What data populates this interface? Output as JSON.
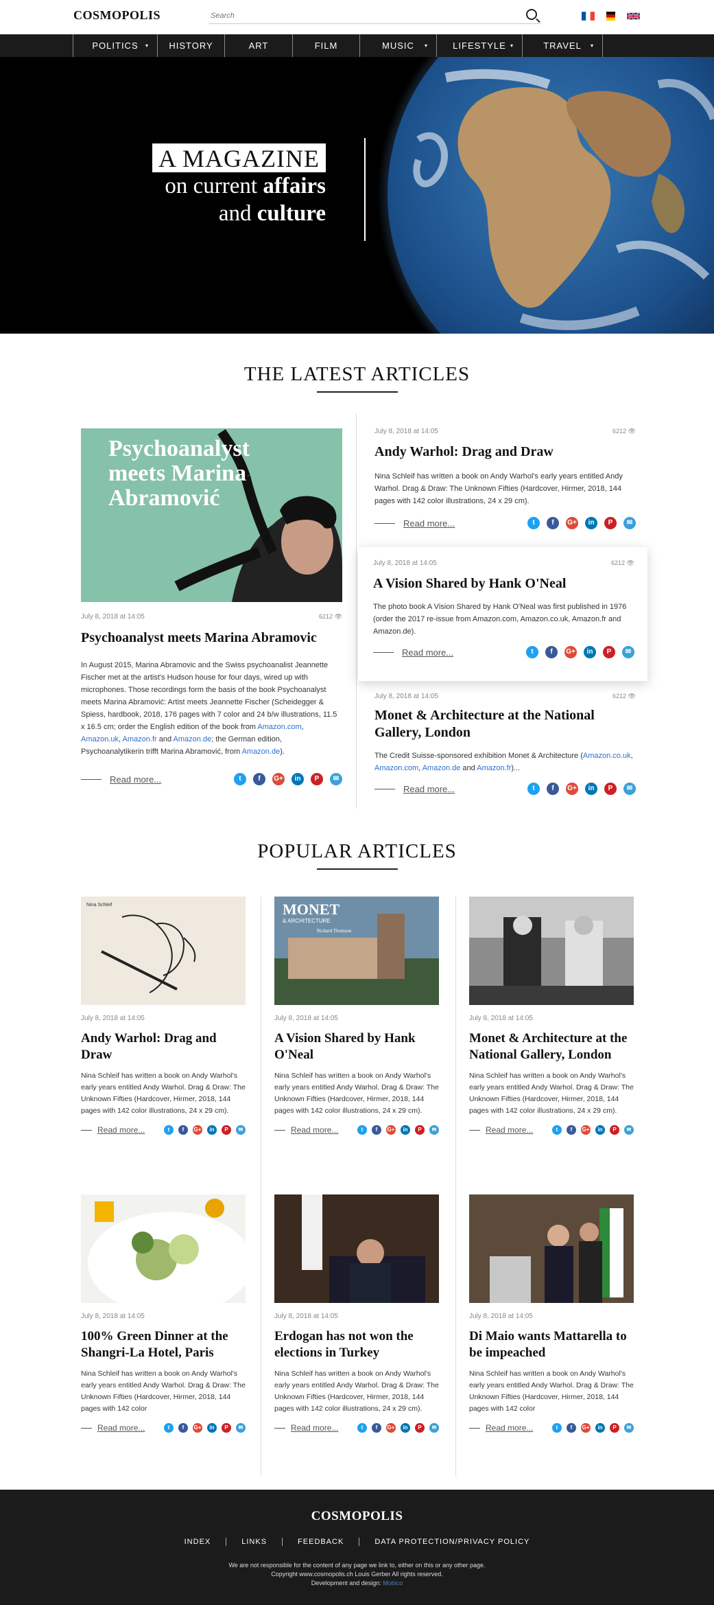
{
  "header": {
    "logo": "COSMOPOLIS",
    "search_placeholder": "Search",
    "flags": [
      "fr",
      "de",
      "gb"
    ]
  },
  "nav": [
    {
      "label": "POLITICS",
      "dropdown": true
    },
    {
      "label": "HISTORY",
      "dropdown": false
    },
    {
      "label": "ART",
      "dropdown": false
    },
    {
      "label": "FILM",
      "dropdown": false
    },
    {
      "label": "MUSIC",
      "dropdown": true
    },
    {
      "label": "LIFESTYLE",
      "dropdown": true
    },
    {
      "label": "TRAVEL",
      "dropdown": true
    }
  ],
  "hero": {
    "tag": "A MAGAZINE",
    "line1a": "on current ",
    "line1b": "affairs",
    "line2a": "and ",
    "line2b": "culture"
  },
  "latest": {
    "title": "THE LATEST ARTICLES",
    "feature": {
      "image_text": "Psychoanalyst meets Marina Abramović",
      "date": "July 8, 2018 at 14:05",
      "views": "6212",
      "title": "Psychoanalyst meets Marina Abramovic",
      "body_parts": [
        {
          "t": "In August 2015, Marina Abramovic and the Swiss psychoanalist Jeannette Fischer met at the artist's Hudson house for four days, wired up with microphones. Those recordings form the basis of the book Psychoanalyst meets Marina Abramović: Artist meets Jeannette Fischer (Scheidegger & Spiess, hardbook, 2018, 176 pages with 7 color and 24 b/w illustrations, 11.5 x 16.5 cm; order the English edition of the book from ",
          "link": false
        },
        {
          "t": "Amazon.com",
          "link": true
        },
        {
          "t": ", ",
          "link": false
        },
        {
          "t": "Amazon.uk",
          "link": true
        },
        {
          "t": ", ",
          "link": false
        },
        {
          "t": "Amazon.fr",
          "link": true
        },
        {
          "t": " and ",
          "link": false
        },
        {
          "t": "Amazon.de",
          "link": true
        },
        {
          "t": "; the German edition, Psychoanalytikerin trifft Marina Abramović, from ",
          "link": false
        },
        {
          "t": "Amazon.de",
          "link": true
        },
        {
          "t": ").",
          "link": false
        }
      ],
      "read_more": "Read more..."
    },
    "side": [
      {
        "date": "July 8, 2018 at 14:05",
        "views": "6212",
        "title": "Andy Warhol: Drag and Draw",
        "body_parts": [
          {
            "t": "Nina Schleif has written a book on Andy Warhol's early years entitled Andy Warhol. Drag & Draw: The Unknown Fifties (Hardcover, Hirmer, 2018, 144 pages with 142 color illustrations, 24 x 29 cm).",
            "link": false
          }
        ],
        "read_more": "Read more..."
      },
      {
        "date": "July 8, 2018 at 14:05",
        "views": "6212",
        "title": "A Vision Shared by Hank O'Neal",
        "body_parts": [
          {
            "t": "The photo book A Vision Shared by Hank O'Neal was first published in 1976 (order the 2017 re-issue from Amazon.com, Amazon.co.uk, Amazon.fr and Amazon.de).",
            "link": false
          }
        ],
        "read_more": "Read more..."
      },
      {
        "date": "July 8, 2018 at 14:05",
        "views": "6212",
        "title": "Monet & Architecture at the National Gallery, London",
        "body_parts": [
          {
            "t": "The Credit Suisse-sponsored exhibition Monet & Architecture (",
            "link": false
          },
          {
            "t": "Amazon.co.uk",
            "link": true
          },
          {
            "t": ", ",
            "link": false
          },
          {
            "t": "Amazon.com",
            "link": true
          },
          {
            "t": ", ",
            "link": false
          },
          {
            "t": "Amazon.de",
            "link": true
          },
          {
            "t": " and ",
            "link": false
          },
          {
            "t": "Amazon.fr",
            "link": true
          },
          {
            "t": ")...",
            "link": false
          }
        ],
        "read_more": "Read more..."
      }
    ]
  },
  "social": [
    {
      "name": "twitter-icon",
      "glyph": "t",
      "color": "#1da1f2"
    },
    {
      "name": "facebook-icon",
      "glyph": "f",
      "color": "#3b5998"
    },
    {
      "name": "google-plus-icon",
      "glyph": "G+",
      "color": "#dd4b39"
    },
    {
      "name": "linkedin-icon",
      "glyph": "in",
      "color": "#0077b5"
    },
    {
      "name": "pinterest-icon",
      "glyph": "P",
      "color": "#cb2027"
    },
    {
      "name": "email-icon",
      "glyph": "✉",
      "color": "#3ba1da"
    }
  ],
  "popular": {
    "title": "POPULAR ARTICLES",
    "cards": [
      {
        "image": "warhol",
        "image_label": "Nina Schleif",
        "date": "July 8, 2018 at 14:05",
        "title": "Andy Warhol: Drag and Draw",
        "body": "Nina Schleif has written a book on Andy Warhol's early years entitled Andy Warhol. Drag & Draw: The Unknown Fifties (Hardcover, Hirmer, 2018, 144 pages with 142 color illustrations, 24 x 29 cm).",
        "read_more": "Read more..."
      },
      {
        "image": "monet",
        "image_label": "MONET & ARCHITECTURE Richard Thomson",
        "date": "July 8, 2018 at 14:05",
        "title": "A Vision Shared by Hank O'Neal",
        "body": "Nina Schleif has written a book on Andy Warhol's early years entitled Andy Warhol. Drag & Draw: The Unknown Fifties (Hardcover, Hirmer, 2018, 144 pages with 142 color illustrations, 24 x 29 cm).",
        "read_more": "Read more..."
      },
      {
        "image": "photo-bw",
        "image_label": "",
        "date": "July 8, 2018 at 14:05",
        "title": "Monet & Architecture at the National Gallery, London",
        "body": "Nina Schleif has written a book on Andy Warhol's early years entitled Andy Warhol. Drag & Draw: The Unknown Fifties (Hardcover, Hirmer, 2018, 144 pages with 142 color illustrations, 24 x 29 cm).",
        "read_more": "Read more..."
      },
      {
        "image": "dinner",
        "image_label": "",
        "date": "July 8, 2018 at 14:05",
        "title": "100% Green Dinner at the Shangri-La Hotel, Paris",
        "body": "Nina Schleif has written a book on Andy Warhol's early years entitled Andy Warhol. Drag & Draw: The Unknown Fifties (Hardcover, Hirmer, 2018, 144 pages with 142 color",
        "read_more": "Read more..."
      },
      {
        "image": "erdogan",
        "image_label": "",
        "date": "July 8, 2018 at 14:05",
        "title": "Erdogan has not won the elections in Turkey",
        "body": "Nina Schleif has written a book on Andy Warhol's early years entitled Andy Warhol. Drag & Draw: The Unknown Fifties (Hardcover, Hirmer, 2018, 144 pages with 142 color illustrations, 24 x 29 cm).",
        "read_more": "Read more..."
      },
      {
        "image": "dimaio",
        "image_label": "",
        "date": "July 8, 2018 at 14:05",
        "title": "Di Maio wants Mattarella to be impeached",
        "body": "Nina Schleif has written a book on Andy Warhol's early years entitled Andy Warhol. Drag & Draw: The Unknown Fifties (Hardcover, Hirmer, 2018, 144 pages with 142 color",
        "read_more": "Read more..."
      }
    ]
  },
  "footer": {
    "logo": "COSMOPOLIS",
    "links": [
      "INDEX",
      "LINKS",
      "FEEDBACK",
      "DATA PROTECTION/PRIVACY POLICY"
    ],
    "note1": "We are not responsible for the content of any page we link to, either on this or any other page.",
    "note2": "Copyright www.cosmopolis.ch Louis Gerber All rights reserved.",
    "note3a": "Development and design: ",
    "note3b": "Mobico"
  }
}
